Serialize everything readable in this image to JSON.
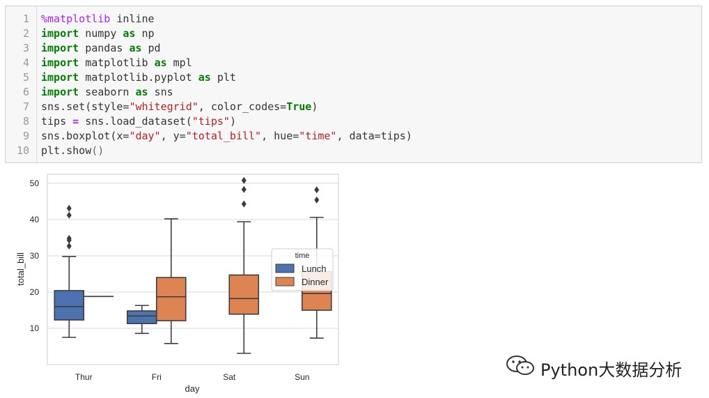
{
  "code": {
    "lines": [
      {
        "n": "1",
        "parts": [
          {
            "t": "%matplotlib",
            "c": "magic"
          },
          {
            "t": " inline",
            "c": ""
          }
        ]
      },
      {
        "n": "2",
        "parts": [
          {
            "t": "import",
            "c": "kw"
          },
          {
            "t": " numpy ",
            "c": ""
          },
          {
            "t": "as",
            "c": "kw"
          },
          {
            "t": " np",
            "c": ""
          }
        ]
      },
      {
        "n": "3",
        "parts": [
          {
            "t": "import",
            "c": "kw"
          },
          {
            "t": " pandas ",
            "c": ""
          },
          {
            "t": "as",
            "c": "kw"
          },
          {
            "t": " pd",
            "c": ""
          }
        ]
      },
      {
        "n": "4",
        "parts": [
          {
            "t": "import",
            "c": "kw"
          },
          {
            "t": " matplotlib ",
            "c": ""
          },
          {
            "t": "as",
            "c": "kw"
          },
          {
            "t": " mpl",
            "c": ""
          }
        ]
      },
      {
        "n": "5",
        "parts": [
          {
            "t": "import",
            "c": "kw"
          },
          {
            "t": " matplotlib.pyplot ",
            "c": ""
          },
          {
            "t": "as",
            "c": "kw"
          },
          {
            "t": " plt",
            "c": ""
          }
        ]
      },
      {
        "n": "6",
        "parts": [
          {
            "t": "import",
            "c": "kw"
          },
          {
            "t": " seaborn ",
            "c": ""
          },
          {
            "t": "as",
            "c": "kw"
          },
          {
            "t": " sns",
            "c": ""
          }
        ]
      },
      {
        "n": "7",
        "parts": [
          {
            "t": "sns.set(style=",
            "c": ""
          },
          {
            "t": "\"whitegrid\"",
            "c": "str"
          },
          {
            "t": ", color_codes=",
            "c": ""
          },
          {
            "t": "True",
            "c": "kw"
          },
          {
            "t": ")",
            "c": ""
          }
        ]
      },
      {
        "n": "8",
        "parts": [
          {
            "t": "tips ",
            "c": ""
          },
          {
            "t": "=",
            "c": "op"
          },
          {
            "t": " sns.load_dataset(",
            "c": ""
          },
          {
            "t": "\"tips\"",
            "c": "str"
          },
          {
            "t": ")",
            "c": ""
          }
        ]
      },
      {
        "n": "9",
        "parts": [
          {
            "t": "sns.boxplot(x=",
            "c": ""
          },
          {
            "t": "\"day\"",
            "c": "str"
          },
          {
            "t": ", y=",
            "c": ""
          },
          {
            "t": "\"total_bill\"",
            "c": "str"
          },
          {
            "t": ", hue=",
            "c": ""
          },
          {
            "t": "\"time\"",
            "c": "str"
          },
          {
            "t": ", data=tips)",
            "c": ""
          }
        ]
      },
      {
        "n": "10",
        "parts": [
          {
            "t": "plt.show",
            "c": ""
          },
          {
            "t": "()",
            "c": "paren"
          }
        ]
      }
    ]
  },
  "chart_data": {
    "type": "box",
    "xlabel": "day",
    "ylabel": "total_bill",
    "categories": [
      "Thur",
      "Fri",
      "Sat",
      "Sun"
    ],
    "ylim": [
      0,
      52.5
    ],
    "yticks": [
      10,
      20,
      30,
      40,
      50
    ],
    "grid": true,
    "legend": {
      "title": "time",
      "placement": "center-right",
      "entries": [
        "Lunch",
        "Dinner"
      ]
    },
    "series": [
      {
        "name": "Lunch",
        "color": "#4c72b0",
        "boxes": [
          {
            "category": "Thur",
            "whislo": 7.5,
            "q1": 12.3,
            "median": 16.0,
            "q3": 20.4,
            "whishi": 29.8,
            "fliers": [
              32.7,
              34.3,
              34.8,
              41.2,
              43.1
            ]
          },
          {
            "category": "Fri",
            "whislo": 8.6,
            "q1": 11.3,
            "median": 13.4,
            "q3": 14.8,
            "whishi": 16.3,
            "fliers": []
          },
          null,
          null
        ]
      },
      {
        "name": "Dinner",
        "color": "#dd8452",
        "boxes": [
          {
            "category": "Thur",
            "whislo": 18.8,
            "q1": 18.8,
            "median": 18.8,
            "q3": 18.8,
            "whishi": 18.8,
            "fliers": []
          },
          {
            "category": "Fri",
            "whislo": 5.8,
            "q1": 12.1,
            "median": 18.7,
            "q3": 24.0,
            "whishi": 40.2,
            "fliers": []
          },
          {
            "category": "Sat",
            "whislo": 3.1,
            "q1": 13.9,
            "median": 18.2,
            "q3": 24.7,
            "whishi": 39.4,
            "fliers": [
              44.3,
              48.3,
              50.8
            ]
          },
          {
            "category": "Sun",
            "whislo": 7.3,
            "q1": 14.99,
            "median": 19.6,
            "q3": 25.6,
            "whishi": 40.6,
            "fliers": [
              45.4,
              48.2
            ]
          }
        ]
      }
    ]
  },
  "watermark": {
    "text": "Python大数据分析"
  }
}
